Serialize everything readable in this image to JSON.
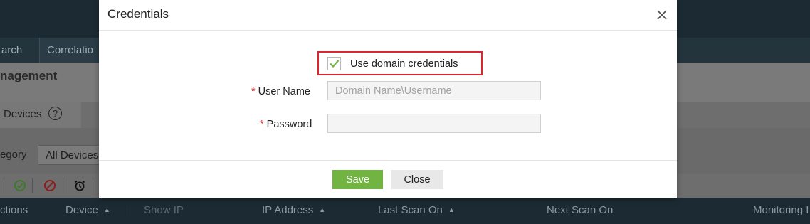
{
  "background": {
    "tabs": [
      {
        "label": "arch"
      },
      {
        "label": "Correlatio"
      }
    ],
    "page_title": "nagement",
    "subtab": {
      "label": "Devices",
      "help_icon": "question-circle-icon"
    },
    "filter": {
      "label": "egory",
      "value": "All Devices"
    },
    "toolbar_icons": [
      "check-circle-icon",
      "ban-icon",
      "alarm-clock-icon"
    ],
    "grid_headers": {
      "actions": "ctions",
      "device": "Device",
      "show_ip": "Show IP",
      "ip_address": "IP Address",
      "last_scan": "Last Scan On",
      "next_scan": "Next Scan On",
      "monitoring": "Monitoring I"
    }
  },
  "modal": {
    "title": "Credentials",
    "close_icon": "close-icon",
    "use_domain": {
      "label": "Use domain credentials",
      "checked": true
    },
    "username": {
      "label": "User Name",
      "placeholder": "Domain Name\\Username",
      "value": ""
    },
    "password": {
      "label": "Password",
      "value": ""
    },
    "save_label": "Save",
    "close_label": "Close"
  },
  "colors": {
    "accent_green": "#72b442",
    "highlight_red": "#d9262c",
    "header_dark": "#1c2b33"
  }
}
